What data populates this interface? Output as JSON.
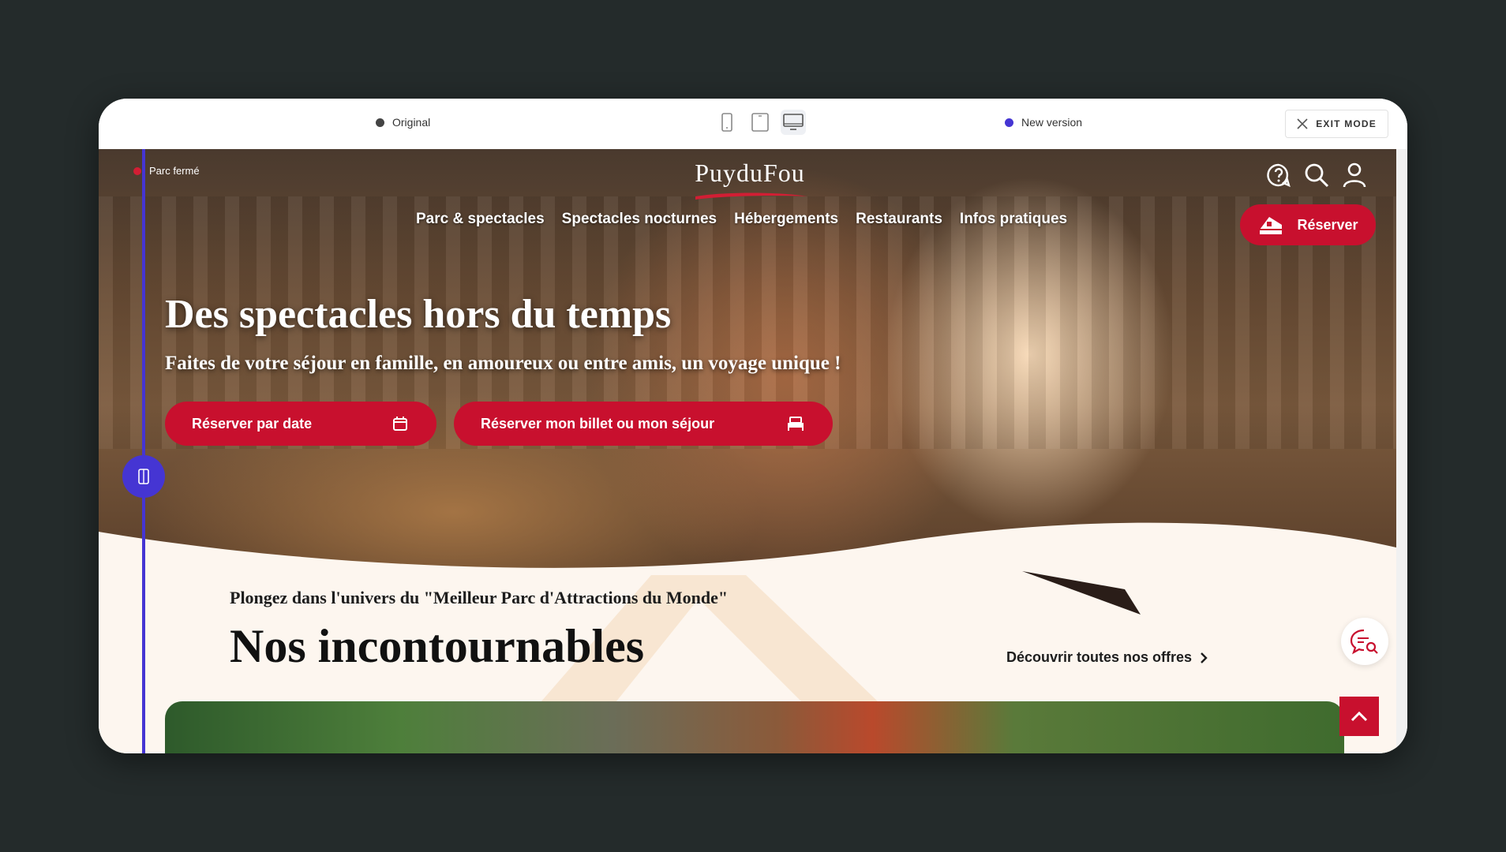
{
  "toolbar": {
    "original_label": "Original",
    "new_version_label": "New version",
    "exit_label": "EXIT MODE",
    "colors": {
      "original_dot": "#444444",
      "new_dot": "#4535d3"
    },
    "devices": [
      "mobile-icon",
      "tablet-icon",
      "desktop-icon"
    ],
    "active_device": "desktop"
  },
  "site": {
    "status": "Parc fermé",
    "logo": "PuyduFou",
    "nav": [
      "Parc & spectacles",
      "Spectacles nocturnes",
      "Hébergements",
      "Restaurants",
      "Infos pratiques"
    ],
    "reserve_label": "Réserver",
    "hero": {
      "title": "Des spectacles hors du temps",
      "subtitle": "Faites de votre séjour en famille, en amoureux ou entre amis, un voyage unique !",
      "cta_date": "Réserver par date",
      "cta_stay": "Réserver mon billet ou mon séjour"
    },
    "section": {
      "kicker": "Plongez dans l'univers du \"Meilleur Parc d'Attractions du Monde\"",
      "title": "Nos incontournables",
      "discover": "Découvrir toutes nos offres"
    },
    "colors": {
      "brand_red": "#c8102e",
      "compare_blue": "#4535d3",
      "cream": "#fdf6ef"
    }
  }
}
